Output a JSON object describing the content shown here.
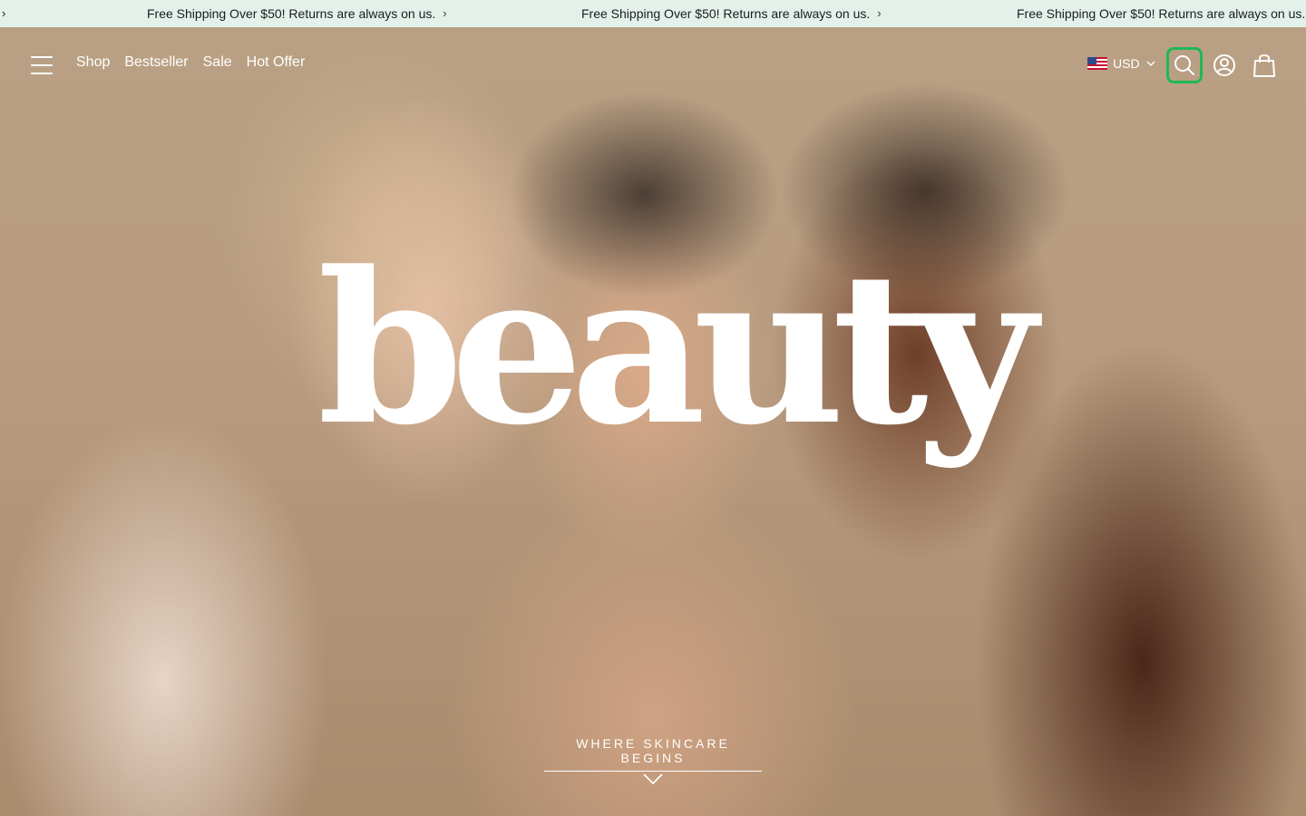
{
  "announcement": {
    "messages": [
      "Free Shipping Over $50! Returns are always on us.",
      "Free Shipping Over $50! Returns are always on us.",
      "Free Shipping Over $50! Returns are always on us."
    ],
    "chevron": "›",
    "background": "#e3f1ea"
  },
  "nav": {
    "links": [
      "Shop",
      "Bestseller",
      "Sale",
      "Hot Offer"
    ],
    "currency": "USD",
    "icons": {
      "menu": "hamburger-icon",
      "search": "search-icon",
      "account": "account-icon",
      "cart": "shopping-bag-icon"
    },
    "search_highlight": "#1db954"
  },
  "hero": {
    "wordmark": "beauty",
    "tagline": "WHERE SKINCARE BEGINS"
  }
}
